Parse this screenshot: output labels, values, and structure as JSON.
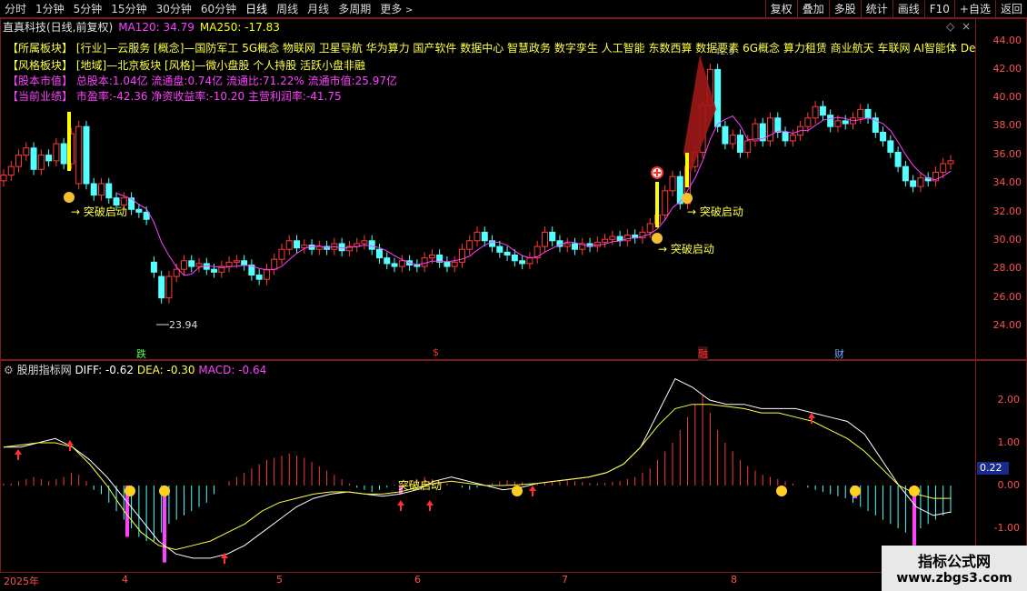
{
  "toolbar": {
    "tabs": [
      "分时",
      "1分钟",
      "5分钟",
      "15分钟",
      "30分钟",
      "60分钟",
      "日线",
      "周线",
      "月线",
      "多周期",
      "更多"
    ],
    "more_icon": "chevron-right-icon",
    "tools": [
      "复权",
      "叠加",
      "多股",
      "统计",
      "画线",
      "F10",
      "+自选",
      "返回"
    ]
  },
  "title": {
    "stock": "直真科技(日线,前复权)",
    "ma120": "MA120: 34.79",
    "ma250": "MA250: -17.83"
  },
  "info": {
    "sector_label": "【所属板块】",
    "sector_value": "[行业]—云服务 [概念]—国防军工 5G概念 物联网 卫星导航 华为算力 国产软件 数据中心 智慧政务 数字孪生 人工智能 东数西算 数据要素 6G概念 算力租赁 商业航天 车联网 AI智能体 DeepS",
    "style_label": "【风格板块】",
    "style_value": "[地域]—北京板块 [风格]—微小盘股 个人持股 活跃小盘非融",
    "capital_label": "【股本市值】",
    "capital_value": "总股本:1.04亿 流通盘:0.74亿 流通比:71.22% 流通市值:25.97亿",
    "perf_label": "【当前业绩】",
    "perf_value": "市盈率:-42.36 净资收益率:-10.20 主营利润率:-41.75"
  },
  "price_axis": [
    "44.00",
    "42.00",
    "40.00",
    "38.00",
    "36.00",
    "34.00",
    "32.00",
    "30.00",
    "28.00",
    "26.00",
    "24.00"
  ],
  "annotations": {
    "low": "23.94",
    "high_partial": "42.9",
    "breakout1": "突破启动",
    "breakout2": "突破启动",
    "breakout3": "突破启动",
    "fall": "跌",
    "dollar": "$",
    "news": "融",
    "finance": "财"
  },
  "indicator": {
    "name": "股朋指标网",
    "diff": "DIFF: -0.62",
    "dea": "DEA: -0.30",
    "macd": "MACD: -0.64",
    "breakout_label": "突破启动",
    "axis": [
      "2.00",
      "1.00",
      "0.00",
      "-1.00"
    ],
    "current": "0.22"
  },
  "dates": [
    "2025年",
    "4",
    "5",
    "6",
    "7",
    "8"
  ],
  "watermark": {
    "title": "指标公式网",
    "url": "www.zbgs3.com"
  },
  "colors": {
    "up": "#ff3b3b",
    "down": "#54ffff",
    "ma": "#ff40ff",
    "yellow": "#ffff00",
    "border": "#7a1a1a"
  }
}
